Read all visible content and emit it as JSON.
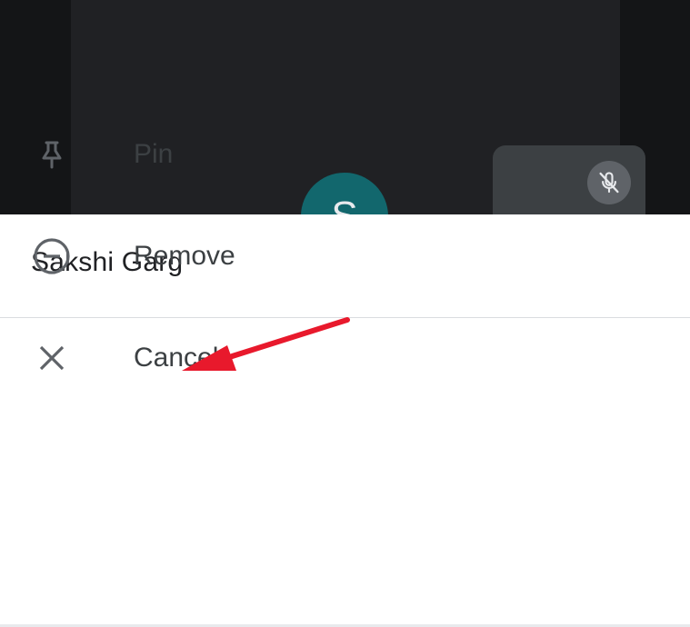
{
  "participant": {
    "avatar_initial": "S",
    "name": "Sakshi Garg"
  },
  "self_view": {
    "mic_icon": "mic-off-icon"
  },
  "menu": {
    "items": [
      {
        "label": "Pin",
        "icon": "pin-icon"
      },
      {
        "label": "Remove",
        "icon": "remove-circle-icon"
      },
      {
        "label": "Cancel",
        "icon": "close-icon"
      }
    ]
  },
  "annotation": {
    "color": "#e8192c",
    "target": "Pin"
  },
  "colors": {
    "video_background": "#141517",
    "tile_background": "#202124",
    "avatar_background": "#12676d",
    "sheet_background": "#ffffff",
    "text_primary": "#202124",
    "text_secondary": "#3c4043",
    "icon": "#5f6368"
  }
}
